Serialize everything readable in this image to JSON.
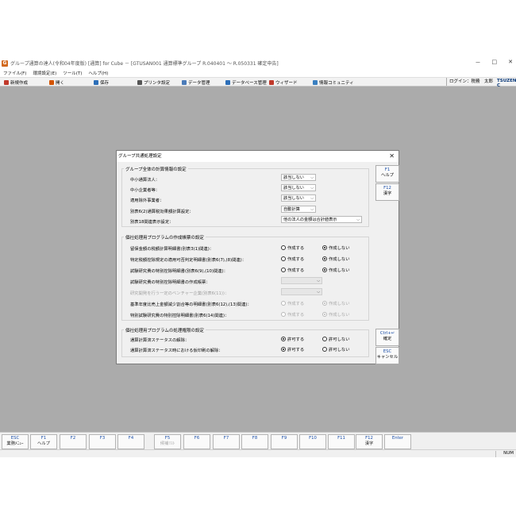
{
  "window": {
    "title": "グループ通算の達人(令和04年度版) [通算] for Cube － [GTUSAN001 通算標準グループ R.040401 ～ R.050331 確定申告]",
    "minimize": "－",
    "maximize": "□",
    "close": "✕"
  },
  "menu": [
    "ファイル(F)",
    "環境設定(E)",
    "ツール(T)",
    "ヘルプ(H)"
  ],
  "toolbar": {
    "buttons": [
      {
        "label": "新規作成",
        "color": "#c0392b"
      },
      {
        "label": "開く",
        "color": "#d35400"
      },
      {
        "label": "保存",
        "color": "#2d6fb8"
      },
      {
        "label": "プリンタ設定",
        "color": "#555555"
      },
      {
        "label": "データ管理",
        "color": "#4b7bb8"
      },
      {
        "label": "データベース管理",
        "color": "#2d6fb8"
      },
      {
        "label": "ウィザード",
        "color": "#c0392b"
      },
      {
        "label": "情報コミュニティ",
        "color": "#3a7fc0"
      }
    ],
    "login": "ログイン：税務　太郎",
    "logo": "TSUZEN C"
  },
  "dialog": {
    "title": "グループ共通処理設定",
    "close": "✕",
    "group1": {
      "title": "グループ全体の計算情報の設定",
      "rows": [
        {
          "label": "中小通算法人：",
          "value": "該当しない"
        },
        {
          "label": "中小企業者等：",
          "value": "該当しない"
        },
        {
          "label": "適用除外事業者：",
          "value": "該当しない"
        },
        {
          "label": "別表6(2)通算税効果額計算設定：",
          "value": "自動計算"
        },
        {
          "label": "別表18関連表示設定：",
          "value": "他の法人の金額は合計値表示"
        }
      ]
    },
    "group2": {
      "title": "個社処理用プログラムの作成帳票の設定",
      "radio_create": "作成する",
      "radio_nocreate": "作成しない",
      "rows": [
        {
          "label": "留保金額の税額計算明細書(別表3(1)関連)：",
          "sel": "no"
        },
        {
          "label": "特定税額控除規定の適用可否判定明細書(別表6(7),(8)関連)：",
          "sel": "no"
        },
        {
          "label": "試験研究費の特別控除明細書(別表6(9),(10)関連)：",
          "sel": "no"
        },
        {
          "label": "試験研究費の特別控除明細書の作成帳票：",
          "combo": ""
        },
        {
          "label": "研究開発を行う一定のベンチャー企業(別表6(11))：",
          "combo": "",
          "disabled": true
        },
        {
          "label": "基準年度比売上金額減少割合等の明細書(別表6(12),(13)関連)：",
          "sel": "no",
          "disabled": true
        },
        {
          "label": "特別試験研究費の特別控除明細書(別表6(14)関連)：",
          "sel": "no",
          "disabled": true
        }
      ]
    },
    "group3": {
      "title": "個社処理用プログラムの処理権限の設定",
      "radio_allow": "許可する",
      "radio_deny": "許可しない",
      "rows": [
        {
          "label": "通算計算済ステータスの解除：",
          "sel": "allow"
        },
        {
          "label": "通算計算済ステータス時における仮印刷の解除：",
          "sel": "allow"
        }
      ]
    },
    "side": [
      {
        "key": "F1",
        "label": "ヘルプ"
      },
      {
        "key": "F12",
        "label": "漢字"
      },
      {
        "key": "Ctrl+↵",
        "label": "確定"
      },
      {
        "key": "ESC",
        "label": "キャンセル"
      }
    ]
  },
  "fkeys": [
    {
      "key": "ESC",
      "label": "業務ﾒﾆｭｰ"
    },
    {
      "key": "F1",
      "label": "ヘルプ"
    },
    {
      "key": "F2",
      "label": ""
    },
    {
      "key": "F3",
      "label": ""
    },
    {
      "key": "F4",
      "label": ""
    },
    {
      "key": "F5",
      "label": "候補ﾘｽﾄ",
      "disabled": true
    },
    {
      "key": "F6",
      "label": ""
    },
    {
      "key": "F7",
      "label": ""
    },
    {
      "key": "F8",
      "label": ""
    },
    {
      "key": "F9",
      "label": ""
    },
    {
      "key": "F10",
      "label": ""
    },
    {
      "key": "F11",
      "label": ""
    },
    {
      "key": "F12",
      "label": "漢字"
    },
    {
      "key": "Enter",
      "label": ""
    }
  ],
  "status": {
    "num": "NUM"
  }
}
